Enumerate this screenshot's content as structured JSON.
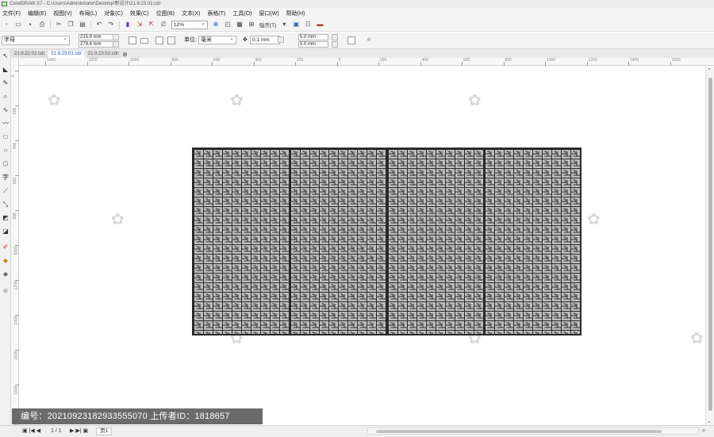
{
  "window": {
    "title": "CorelDRAW X7 - C:\\Users\\Administrator\\Desktop\\新设计\\21.9.23.01.cdr"
  },
  "menu": [
    "文件(F)",
    "编辑(E)",
    "视图(V)",
    "布局(L)",
    "对象(C)",
    "效果(C)",
    "位图(B)",
    "文本(X)",
    "表格(T)",
    "工具(O)",
    "窗口(W)",
    "帮助(H)"
  ],
  "toolbar": {
    "zoom_level": "12%",
    "snap_label": "贴齐(T)"
  },
  "property_bar": {
    "font_name": "字母",
    "width": "215.9 mm",
    "height": "279.4 mm",
    "units_label": "单位:",
    "units_value": "毫米",
    "nudge": "0.1 mm",
    "dup_x": "5.0 mm",
    "dup_y": "5.0 mm"
  },
  "tabs": [
    "21.9.22.02.cdr",
    "21.9.23.01.cdr",
    "21.9.23.02.cdr"
  ],
  "active_tab": "21.9.23.01.cdr",
  "rulers": {
    "horizontal_labels": [
      "1400",
      "1200",
      "1000",
      "800",
      "600",
      "400",
      "200",
      "0",
      "200",
      "400",
      "600",
      "800",
      "1000",
      "1200",
      "1400",
      "1600"
    ],
    "vertical_labels": [
      "0",
      "200",
      "400",
      "600",
      "800",
      "1000",
      "1200",
      "1400",
      "1600",
      "1800",
      "2000"
    ]
  },
  "canvas": {
    "panel_count": 4,
    "panel_colors": {
      "fill": "#bdbdbd",
      "lattice": "#2a2a2a",
      "frame": "#2a2a2a"
    }
  },
  "status": {
    "page_counter": "1 / 1",
    "page_tab": "页1"
  },
  "watermark_banner": {
    "text": "编号：20210923182933555070 上传者ID：1818657"
  },
  "icons": [
    "new-doc-icon",
    "open-icon",
    "save-icon",
    "print-icon",
    "cut-icon",
    "copy-icon",
    "paste-icon",
    "undo-icon",
    "redo-icon",
    "import-icon",
    "export-icon",
    "publish-icon",
    "pick-tool-icon",
    "shape-tool-icon",
    "zoom-tool-icon",
    "freehand-tool-icon",
    "rectangle-tool-icon",
    "ellipse-tool-icon",
    "text-tool-icon",
    "fill-tool-icon"
  ]
}
